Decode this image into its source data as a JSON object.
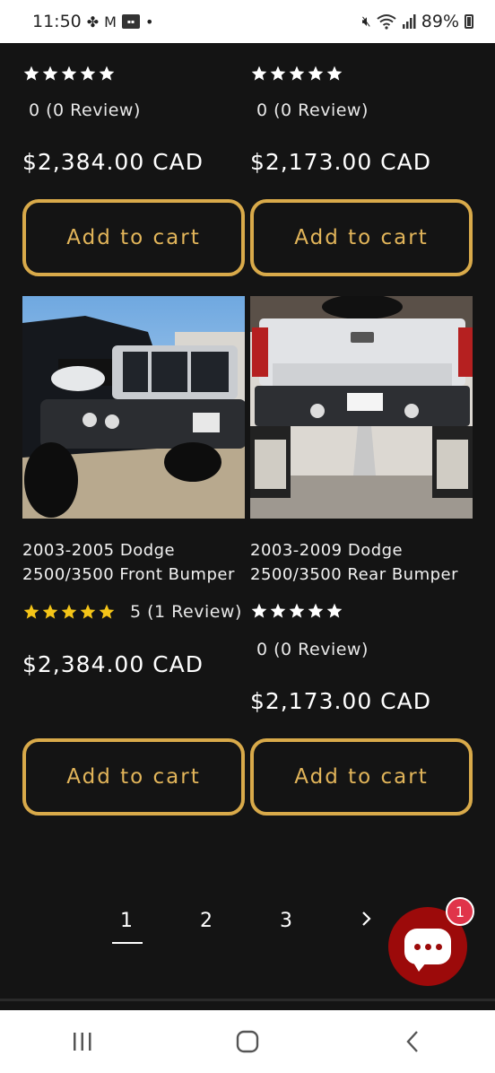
{
  "status_bar": {
    "time": "11:50",
    "battery": "89%"
  },
  "rows": [
    {
      "products": [
        {
          "title": "",
          "rating_stars": 0,
          "rating_text": "0 (0 Review)",
          "price": "$2,384.00 CAD",
          "button": "Add to cart"
        },
        {
          "title": "",
          "rating_stars": 0,
          "rating_text": "0 (0 Review)",
          "price": "$2,173.00 CAD",
          "button": "Add to cart"
        }
      ]
    },
    {
      "products": [
        {
          "title_line1": "2003-2005 Dodge",
          "title_line2": "2500/3500 Front Bumper",
          "rating_stars": 5,
          "rating_text": "5 (1 Review)",
          "price": "$2,384.00 CAD",
          "button": "Add to cart"
        },
        {
          "title_line1": "2003-2009 Dodge",
          "title_line2": "2500/3500 Rear Bumper",
          "rating_stars": 0,
          "rating_text": "0 (0 Review)",
          "price": "$2,173.00 CAD",
          "button": "Add to cart"
        }
      ]
    }
  ],
  "pagination": {
    "pages": [
      "1",
      "2",
      "3"
    ],
    "current": "1",
    "next_icon": "chevron-right-icon"
  },
  "chat": {
    "badge_count": "1",
    "icon": "chat-bubble-icon"
  },
  "colors": {
    "background": "#141414",
    "accent_gold": "#d9aa4a",
    "star_gold": "#f5c518",
    "chat_red": "#9c0a0a"
  }
}
